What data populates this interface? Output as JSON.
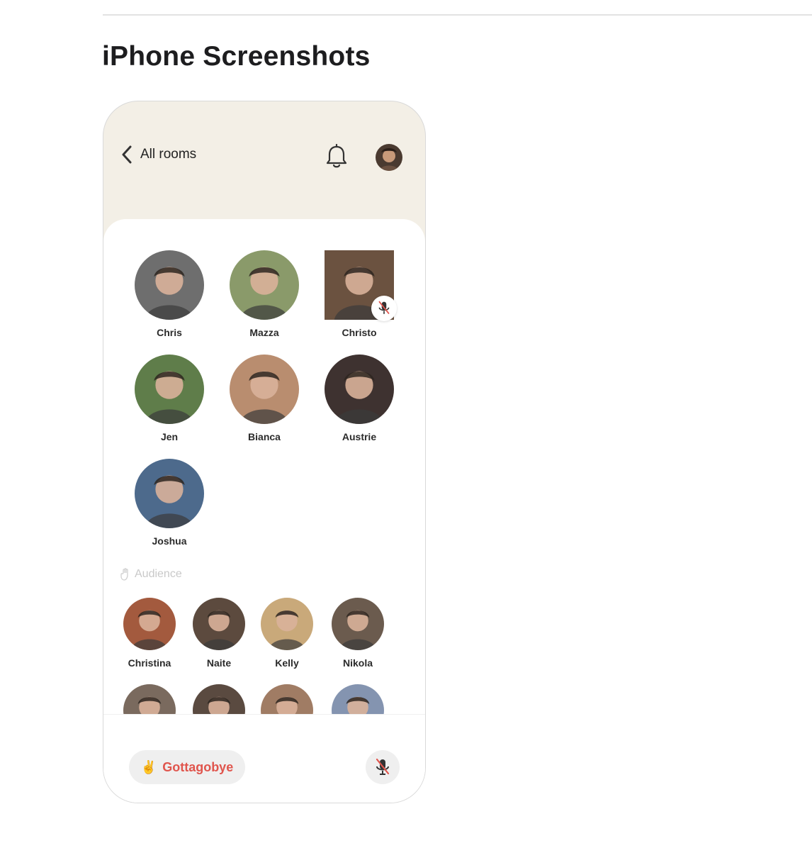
{
  "page": {
    "section_title": "iPhone Screenshots"
  },
  "room": {
    "back_label": "All rooms",
    "speakers": [
      {
        "name": "Chris",
        "muted": false,
        "color": "#6e6e6e"
      },
      {
        "name": "Mazza",
        "muted": false,
        "color": "#8a9a6a"
      },
      {
        "name": "Christo",
        "muted": true,
        "color": "#6b5240"
      },
      {
        "name": "Jen",
        "muted": false,
        "color": "#5f7d4a"
      },
      {
        "name": "Bianca",
        "muted": false,
        "color": "#b98d6f"
      },
      {
        "name": "Austrie",
        "muted": false,
        "color": "#3e3230"
      },
      {
        "name": "Joshua",
        "muted": false,
        "color": "#4d6a8c"
      }
    ],
    "audience_label": "Audience",
    "audience": [
      {
        "name": "Christina",
        "color": "#a35a3e"
      },
      {
        "name": "Naite",
        "color": "#5c4a3e"
      },
      {
        "name": "Kelly",
        "color": "#c9a97a"
      },
      {
        "name": "Nikola",
        "color": "#6b5b4e"
      },
      {
        "name": "",
        "color": "#7a6a5e"
      },
      {
        "name": "",
        "color": "#5a4a40"
      },
      {
        "name": "",
        "color": "#a07c64"
      },
      {
        "name": "",
        "color": "#8494b0"
      }
    ],
    "leave_emoji": "✌️",
    "leave_label": "Gottagobye"
  },
  "colors": {
    "accent_red": "#e0554d",
    "header_bg": "#f3efe6"
  },
  "icons": {
    "back": "chevron-left-icon",
    "bell": "bell-icon",
    "mic_off": "mic-off-icon",
    "audience": "hand-icon"
  }
}
